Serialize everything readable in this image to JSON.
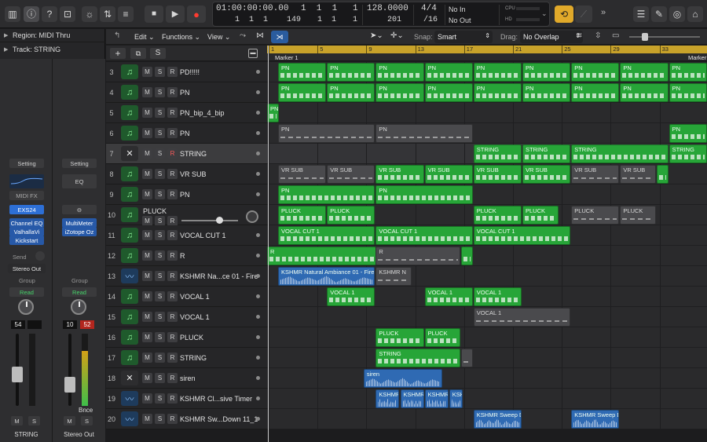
{
  "toolbar": {
    "lcd": {
      "time": "01:00:00:00.00",
      "time_sub": "1  1  1    149",
      "bar_top": "1  1  1",
      "bar_top_last": "1",
      "bar_bottom": "1  1",
      "bar_bottom_last": "1",
      "tempo": "128.0000",
      "tempo_sub": "201",
      "sig": "4/4",
      "sig_sub": "/16",
      "in": "No In",
      "out": "No Out",
      "cpu": "CPU",
      "hd": "HD"
    }
  },
  "inspector": {
    "region_label": "Region: MIDI Thru",
    "track_label": "Track: STRING",
    "strip1": {
      "setting": "Setting",
      "midi_fx": "MIDI FX",
      "instrument": "EXS24",
      "plugins": [
        "Channel EQ",
        "ValhallaVi",
        "Kickstart"
      ],
      "send": "Send",
      "output": "Stereo Out",
      "group": "Group",
      "automation": "Read",
      "vol": "54",
      "name": "STRING"
    },
    "strip2": {
      "setting": "Setting",
      "eq": "EQ",
      "plugins": [
        "MultiMeter",
        "iZotope Oz"
      ],
      "group": "Group",
      "automation": "Read",
      "vol": "10",
      "peak": "52",
      "bounce": "Bnce",
      "name": "Stereo Out"
    },
    "m": "M",
    "s": "S"
  },
  "menubar": {
    "edit": "Edit",
    "functions": "Functions",
    "view": "View",
    "snap_label": "Snap:",
    "snap_value": "Smart",
    "drag_label": "Drag:",
    "drag_value": "No Overlap"
  },
  "track_header": {
    "add": "+",
    "s": "S"
  },
  "ruler": {
    "bars": [
      "1",
      "5",
      "9",
      "13",
      "17",
      "21",
      "25",
      "29",
      "33"
    ],
    "marker1": "Marker 1",
    "marker2": "Marker"
  },
  "tracks": [
    {
      "num": "3",
      "name": "PD!!!!!",
      "icon": "midi"
    },
    {
      "num": "4",
      "name": "PN",
      "icon": "midi"
    },
    {
      "num": "5",
      "name": "PN_bip_4_bip",
      "icon": "midi"
    },
    {
      "num": "6",
      "name": "PN",
      "icon": "midi"
    },
    {
      "num": "7",
      "name": "STRING",
      "icon": "drum"
    },
    {
      "num": "8",
      "name": "VR SUB",
      "icon": "midi"
    },
    {
      "num": "9",
      "name": "PN",
      "icon": "midi"
    },
    {
      "num": "10",
      "name": "PLUCK",
      "icon": "midi"
    },
    {
      "num": "11",
      "name": "VOCAL CUT 1",
      "icon": "midi"
    },
    {
      "num": "12",
      "name": "R",
      "icon": "midi"
    },
    {
      "num": "13",
      "name": "KSHMR Na...ce 01 - Fire",
      "icon": "audio"
    },
    {
      "num": "14",
      "name": "VOCAL 1",
      "icon": "midi"
    },
    {
      "num": "15",
      "name": "VOCAL 1",
      "icon": "midi"
    },
    {
      "num": "16",
      "name": "PLUCK",
      "icon": "midi"
    },
    {
      "num": "17",
      "name": "STRING",
      "icon": "midi"
    },
    {
      "num": "18",
      "name": "siren",
      "icon": "drum"
    },
    {
      "num": "19",
      "name": "KSHMR Cl...sive Timer",
      "icon": "audio"
    },
    {
      "num": "20",
      "name": "KSHMR Sw...Down 11_1",
      "icon": "audio"
    }
  ],
  "track_buttons": {
    "m": "M",
    "s": "S",
    "r": "R"
  },
  "regions": [
    {
      "row": 0,
      "label": "PN",
      "start": 1,
      "len": 4,
      "kind": "g"
    },
    {
      "row": 0,
      "label": "PN",
      "start": 5,
      "len": 4,
      "kind": "g"
    },
    {
      "row": 0,
      "label": "PN",
      "start": 9,
      "len": 4,
      "kind": "g"
    },
    {
      "row": 0,
      "label": "PN",
      "start": 13,
      "len": 4,
      "kind": "g"
    },
    {
      "row": 0,
      "label": "PN",
      "start": 17,
      "len": 4,
      "kind": "g"
    },
    {
      "row": 0,
      "label": "PN",
      "start": 21,
      "len": 4,
      "kind": "g"
    },
    {
      "row": 0,
      "label": "PN",
      "start": 25,
      "len": 4,
      "kind": "g"
    },
    {
      "row": 0,
      "label": "PN",
      "start": 29,
      "len": 4,
      "kind": "g"
    },
    {
      "row": 0,
      "label": "PN",
      "start": 33,
      "len": 4,
      "kind": "g"
    },
    {
      "row": 1,
      "label": "PN",
      "start": 1,
      "len": 4,
      "kind": "g"
    },
    {
      "row": 1,
      "label": "PN",
      "start": 5,
      "len": 4,
      "kind": "g"
    },
    {
      "row": 1,
      "label": "PN",
      "start": 9,
      "len": 4,
      "kind": "g"
    },
    {
      "row": 1,
      "label": "PN",
      "start": 13,
      "len": 4,
      "kind": "g"
    },
    {
      "row": 1,
      "label": "PN",
      "start": 17,
      "len": 4,
      "kind": "g"
    },
    {
      "row": 1,
      "label": "PN",
      "start": 21,
      "len": 4,
      "kind": "g"
    },
    {
      "row": 1,
      "label": "PN",
      "start": 25,
      "len": 4,
      "kind": "g"
    },
    {
      "row": 1,
      "label": "PN",
      "start": 29,
      "len": 4,
      "kind": "g"
    },
    {
      "row": 1,
      "label": "PN",
      "start": 33,
      "len": 4,
      "kind": "g"
    },
    {
      "row": 2,
      "label": "PN",
      "start": 0,
      "len": 1,
      "kind": "g"
    },
    {
      "row": 3,
      "label": "PN",
      "start": 1,
      "len": 8,
      "kind": "dg"
    },
    {
      "row": 3,
      "label": "PN",
      "start": 9,
      "len": 8,
      "kind": "dg"
    },
    {
      "row": 3,
      "label": "PN",
      "start": 33,
      "len": 4,
      "kind": "g"
    },
    {
      "row": 4,
      "label": "STRING",
      "start": 17,
      "len": 4,
      "kind": "g"
    },
    {
      "row": 4,
      "label": "STRING",
      "start": 21,
      "len": 4,
      "kind": "g"
    },
    {
      "row": 4,
      "label": "STRING",
      "start": 25,
      "len": 8,
      "kind": "g"
    },
    {
      "row": 4,
      "label": "STRING",
      "start": 33,
      "len": 4,
      "kind": "g"
    },
    {
      "row": 5,
      "label": "VR SUB",
      "start": 1,
      "len": 4,
      "kind": "dg"
    },
    {
      "row": 5,
      "label": "VR SUB",
      "start": 5,
      "len": 4,
      "kind": "dg"
    },
    {
      "row": 5,
      "label": "VR SUB",
      "start": 9,
      "len": 4,
      "kind": "g"
    },
    {
      "row": 5,
      "label": "VR SUB",
      "start": 13,
      "len": 4,
      "kind": "g"
    },
    {
      "row": 5,
      "label": "VR SUB",
      "start": 17,
      "len": 4,
      "kind": "g"
    },
    {
      "row": 5,
      "label": "VR SUB",
      "start": 21,
      "len": 4,
      "kind": "g"
    },
    {
      "row": 5,
      "label": "VR SUB",
      "start": 25,
      "len": 4,
      "kind": "dg"
    },
    {
      "row": 5,
      "label": "VR SUB",
      "start": 29,
      "len": 3,
      "kind": "dg"
    },
    {
      "row": 5,
      "label": "",
      "start": 32,
      "len": 1,
      "kind": "g"
    },
    {
      "row": 6,
      "label": "PN",
      "start": 1,
      "len": 8,
      "kind": "g"
    },
    {
      "row": 6,
      "label": "PN",
      "start": 9,
      "len": 8,
      "kind": "g"
    },
    {
      "row": 7,
      "label": "PLUCK",
      "start": 1,
      "len": 4,
      "kind": "g"
    },
    {
      "row": 7,
      "label": "PLUCK",
      "start": 5,
      "len": 4,
      "kind": "g"
    },
    {
      "row": 7,
      "label": "PLUCK",
      "start": 17,
      "len": 4,
      "kind": "g"
    },
    {
      "row": 7,
      "label": "PLUCK",
      "start": 21,
      "len": 3,
      "kind": "g"
    },
    {
      "row": 7,
      "label": "PLUCK",
      "start": 25,
      "len": 4,
      "kind": "dg"
    },
    {
      "row": 7,
      "label": "PLUCK",
      "start": 29,
      "len": 3,
      "kind": "dg"
    },
    {
      "row": 8,
      "label": "VOCAL CUT 1",
      "start": 1,
      "len": 8,
      "kind": "g"
    },
    {
      "row": 8,
      "label": "VOCAL CUT 1",
      "start": 9,
      "len": 8,
      "kind": "g"
    },
    {
      "row": 8,
      "label": "VOCAL CUT 1",
      "start": 17,
      "len": 8,
      "kind": "g"
    },
    {
      "row": 9,
      "label": "R",
      "start": 0,
      "len": 9,
      "kind": "g"
    },
    {
      "row": 9,
      "label": "R",
      "start": 9,
      "len": 7,
      "kind": "dg"
    },
    {
      "row": 9,
      "label": "",
      "start": 16,
      "len": 1,
      "kind": "g"
    },
    {
      "row": 10,
      "label": "KSHMR Natural Ambiance 01 - Fire",
      "start": 1,
      "len": 8,
      "kind": "a"
    },
    {
      "row": 10,
      "label": "KSHMR N",
      "start": 9,
      "len": 3,
      "kind": "dg"
    },
    {
      "row": 11,
      "label": "VOCAL 1",
      "start": 5,
      "len": 4,
      "kind": "g"
    },
    {
      "row": 11,
      "label": "VOCAL 1",
      "start": 13,
      "len": 4,
      "kind": "g"
    },
    {
      "row": 11,
      "label": "VOCAL 1",
      "start": 17,
      "len": 4,
      "kind": "g"
    },
    {
      "row": 12,
      "label": "VOCAL 1",
      "start": 17,
      "len": 8,
      "kind": "dg"
    },
    {
      "row": 13,
      "label": "PLUCK",
      "start": 9,
      "len": 4,
      "kind": "g"
    },
    {
      "row": 13,
      "label": "PLUCK",
      "start": 13,
      "len": 3,
      "kind": "g"
    },
    {
      "row": 14,
      "label": "STRING",
      "start": 9,
      "len": 7,
      "kind": "g"
    },
    {
      "row": 14,
      "label": "",
      "start": 16,
      "len": 1,
      "kind": "dg"
    },
    {
      "row": 15,
      "label": "siren",
      "start": 8,
      "len": 6.5,
      "kind": "a"
    },
    {
      "row": 16,
      "label": "KSHMR",
      "start": 9,
      "len": 2,
      "kind": "a"
    },
    {
      "row": 16,
      "label": "KSHMR",
      "start": 11,
      "len": 2,
      "kind": "a"
    },
    {
      "row": 16,
      "label": "KSHMR",
      "start": 13,
      "len": 2,
      "kind": "a"
    },
    {
      "row": 16,
      "label": "KSH",
      "start": 15,
      "len": 1.2,
      "kind": "a"
    },
    {
      "row": 17,
      "label": "KSHMR Sweep Do",
      "start": 17,
      "len": 4,
      "kind": "a"
    },
    {
      "row": 17,
      "label": "KSHMR Sweep Do",
      "start": 25,
      "len": 4,
      "kind": "a"
    }
  ]
}
